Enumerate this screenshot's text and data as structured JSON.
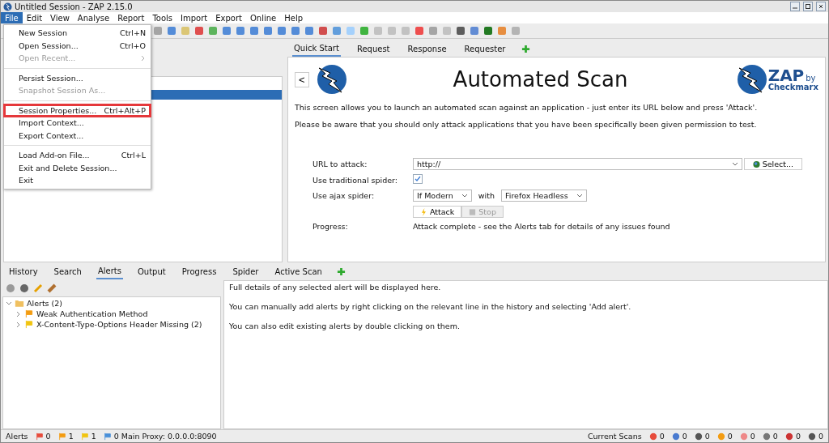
{
  "window": {
    "title": "Untitled Session - ZAP 2.15.0"
  },
  "menubar": [
    {
      "label": "File",
      "selected": true
    },
    {
      "label": "Edit",
      "selected": false
    },
    {
      "label": "View",
      "selected": false
    },
    {
      "label": "Analyse",
      "selected": false
    },
    {
      "label": "Report",
      "selected": false
    },
    {
      "label": "Tools",
      "selected": false
    },
    {
      "label": "Import",
      "selected": false
    },
    {
      "label": "Export",
      "selected": false
    },
    {
      "label": "Online",
      "selected": false
    },
    {
      "label": "Help",
      "selected": false
    }
  ],
  "file_menu": [
    {
      "kind": "item",
      "label": "New Session",
      "shortcut": "Ctrl+N",
      "disabled": false,
      "outlined": false
    },
    {
      "kind": "item",
      "label": "Open Session...",
      "shortcut": "Ctrl+O",
      "disabled": false,
      "outlined": false
    },
    {
      "kind": "submenu",
      "label": "Open Recent...",
      "disabled": true,
      "outlined": false
    },
    {
      "kind": "separator"
    },
    {
      "kind": "item",
      "label": "Persist Session...",
      "disabled": false,
      "outlined": false
    },
    {
      "kind": "item",
      "label": "Snapshot Session As...",
      "disabled": true,
      "outlined": false
    },
    {
      "kind": "separator"
    },
    {
      "kind": "item",
      "label": "Session Properties...",
      "shortcut": "Ctrl+Alt+P",
      "disabled": false,
      "outlined": true
    },
    {
      "kind": "item",
      "label": "Import Context...",
      "disabled": false,
      "outlined": false
    },
    {
      "kind": "item",
      "label": "Export Context...",
      "disabled": false,
      "outlined": false
    },
    {
      "kind": "separator"
    },
    {
      "kind": "item",
      "label": "Load Add-on File...",
      "shortcut": "Ctrl+L",
      "disabled": false,
      "outlined": false
    },
    {
      "kind": "item",
      "label": "Exit and Delete Session...",
      "disabled": false,
      "outlined": false
    },
    {
      "kind": "item",
      "label": "Exit",
      "disabled": false,
      "outlined": false
    }
  ],
  "work_tabs": [
    {
      "label": "Quick Start",
      "selected": true
    },
    {
      "label": "Request",
      "selected": false
    },
    {
      "label": "Response",
      "selected": false
    },
    {
      "label": "Requester",
      "selected": false
    }
  ],
  "quick_start": {
    "back": "<",
    "title": "Automated Scan",
    "logo": {
      "name": "ZAP",
      "by": "by",
      "vendor": "Checkmarx"
    },
    "intro": [
      "This screen allows you to launch an automated scan against  an application - just enter its URL below and press 'Attack'.",
      "Please be aware that you should only attack applications that you have been specifically been given permission to test."
    ],
    "url_label": "URL to attack:",
    "url_value": "http://",
    "select_button": "Select...",
    "traditional_label": "Use traditional spider:",
    "traditional_checked": true,
    "ajax_label": "Use ajax spider:",
    "ajax_mode": "If Modern",
    "with": "with",
    "browser": "Firefox Headless",
    "attack_button": "Attack",
    "stop_button": "Stop",
    "stop_disabled": true,
    "progress_label": "Progress:",
    "progress_text": "Attack complete - see the Alerts tab for details of any issues found"
  },
  "bottom_tabs": [
    {
      "label": "History",
      "selected": false
    },
    {
      "label": "Search",
      "selected": false
    },
    {
      "label": "Alerts",
      "selected": true
    },
    {
      "label": "Output",
      "selected": false
    },
    {
      "label": "Progress",
      "selected": false
    },
    {
      "label": "Spider",
      "selected": false
    },
    {
      "label": "Active Scan",
      "selected": false
    }
  ],
  "alerts_tree": {
    "label": "Alerts (2)",
    "expanded": true,
    "children": [
      {
        "label": "Weak Authentication Method",
        "color": "#f39c12"
      },
      {
        "label": "X-Content-Type-Options Header Missing (2)",
        "color": "#f1c40f"
      }
    ]
  },
  "alert_details": [
    "Full details of any selected alert will be displayed here.",
    "You can manually add alerts by right clicking on the relevant line in the history and selecting 'Add alert'.",
    "You can also edit existing alerts by double clicking on them."
  ],
  "status_bar": {
    "alerts_label": "Alerts",
    "alert_counts": [
      {
        "count": "0",
        "color": "#e74c3c"
      },
      {
        "count": "1",
        "color": "#f39c12"
      },
      {
        "count": "1",
        "color": "#f1c40f"
      },
      {
        "count": "0",
        "color": "#4a90d9"
      }
    ],
    "proxy": "Main Proxy: 0.0.0.0:8090",
    "scans_label": "Current Scans",
    "scan_counts": [
      "0",
      "0",
      "0",
      "0",
      "0",
      "0",
      "0",
      "0"
    ]
  }
}
